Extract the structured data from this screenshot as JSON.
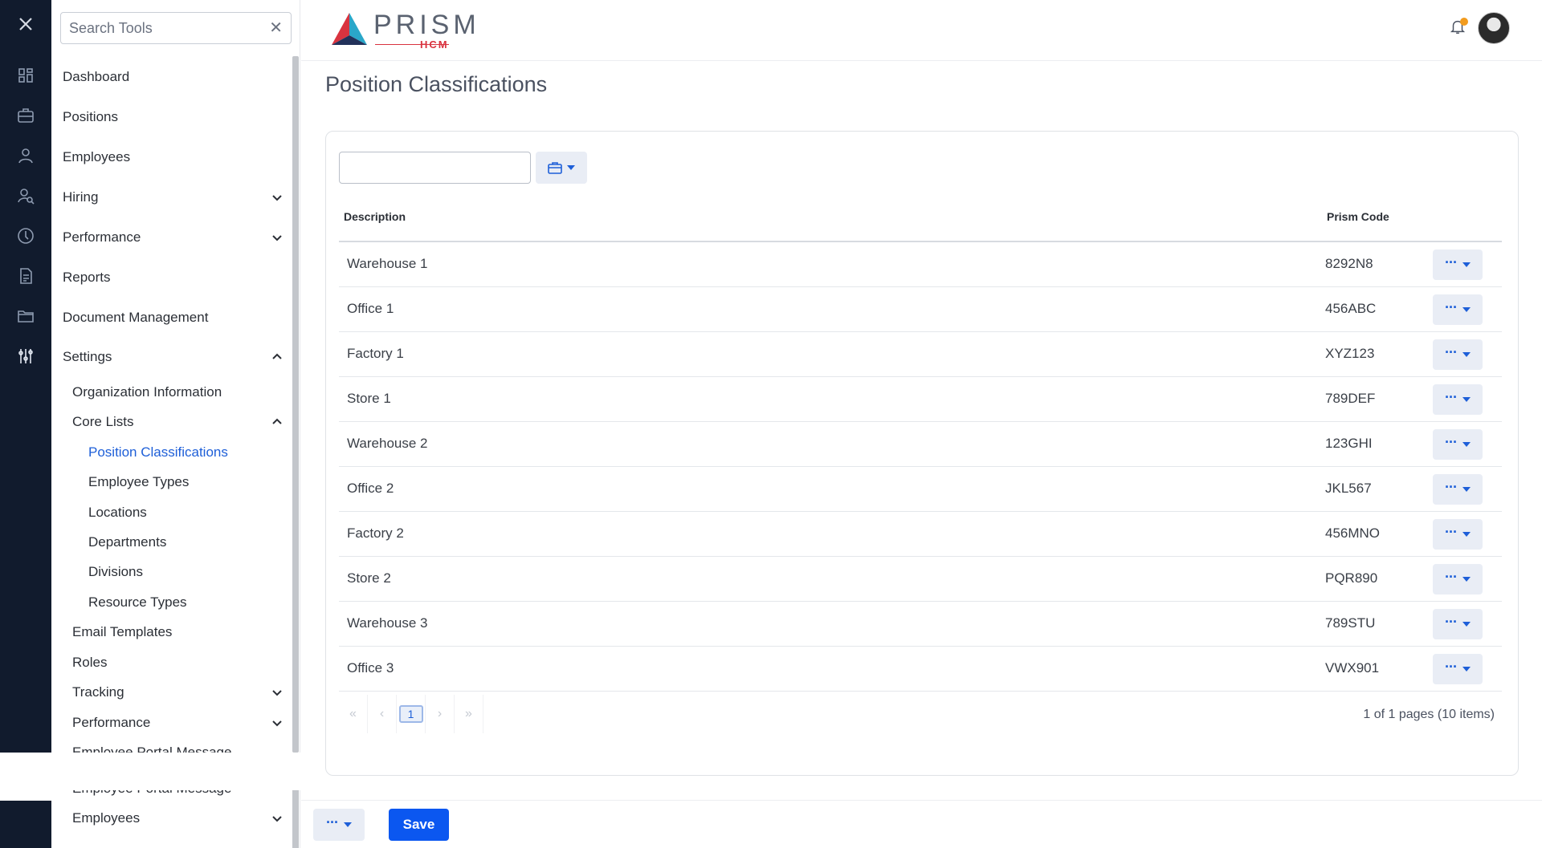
{
  "search": {
    "placeholder": "Search Tools",
    "clear_icon": "✕"
  },
  "rail": {
    "icons": [
      "close-icon",
      "dashboard-icon",
      "briefcase-icon",
      "person-icon",
      "hiring-icon",
      "performance-icon",
      "reports-icon",
      "folder-icon",
      "settings-sliders-icon"
    ]
  },
  "sidebar": {
    "items": [
      {
        "label": "Dashboard"
      },
      {
        "label": "Positions"
      },
      {
        "label": "Employees"
      },
      {
        "label": "Hiring"
      },
      {
        "label": "Performance"
      },
      {
        "label": "Reports"
      },
      {
        "label": "Document Management"
      },
      {
        "label": "Settings"
      }
    ],
    "settings_children": [
      {
        "label": "Organization Information"
      },
      {
        "label": "Core Lists"
      },
      {
        "label": "Email Templates"
      },
      {
        "label": "Roles"
      },
      {
        "label": "Tracking"
      },
      {
        "label": "Performance"
      },
      {
        "label": "Employee Portal Message"
      },
      {
        "label": "Employee Portal Message"
      },
      {
        "label": "Employees"
      }
    ],
    "core_lists_children": [
      {
        "label": "Position Classifications"
      },
      {
        "label": "Employee Types"
      },
      {
        "label": "Locations"
      },
      {
        "label": "Departments"
      },
      {
        "label": "Divisions"
      },
      {
        "label": "Resource Types"
      }
    ]
  },
  "header": {
    "logo_text": "PRISM",
    "logo_sub": "HCM",
    "accent_color": "#d9333f",
    "notification_dot_color": "#f29b1d"
  },
  "page": {
    "title": "Position Classifications"
  },
  "table": {
    "columns": {
      "description": "Description",
      "code": "Prism Code"
    },
    "rows": [
      {
        "description": "Warehouse 1",
        "code": "8292N8"
      },
      {
        "description": "Office 1",
        "code": "456ABC"
      },
      {
        "description": "Factory 1",
        "code": "XYZ123"
      },
      {
        "description": "Store 1",
        "code": "789DEF"
      },
      {
        "description": "Warehouse 2",
        "code": "123GHI"
      },
      {
        "description": "Office 2",
        "code": "JKL567"
      },
      {
        "description": "Factory 2",
        "code": "456MNO"
      },
      {
        "description": "Store 2",
        "code": "PQR890"
      },
      {
        "description": "Warehouse 3",
        "code": "789STU"
      },
      {
        "description": "Office 3",
        "code": "VWX901"
      }
    ],
    "row_action_label": "···"
  },
  "pager": {
    "first": "«",
    "prev": "‹",
    "current": "1",
    "next": "›",
    "last": "»",
    "info": "1 of 1 pages (10 items)"
  },
  "footer": {
    "more_label": "···",
    "save_label": "Save"
  },
  "colors": {
    "primary": "#0b57f0",
    "link_active": "#1e5fd8",
    "rail_bg": "#111b2d"
  }
}
